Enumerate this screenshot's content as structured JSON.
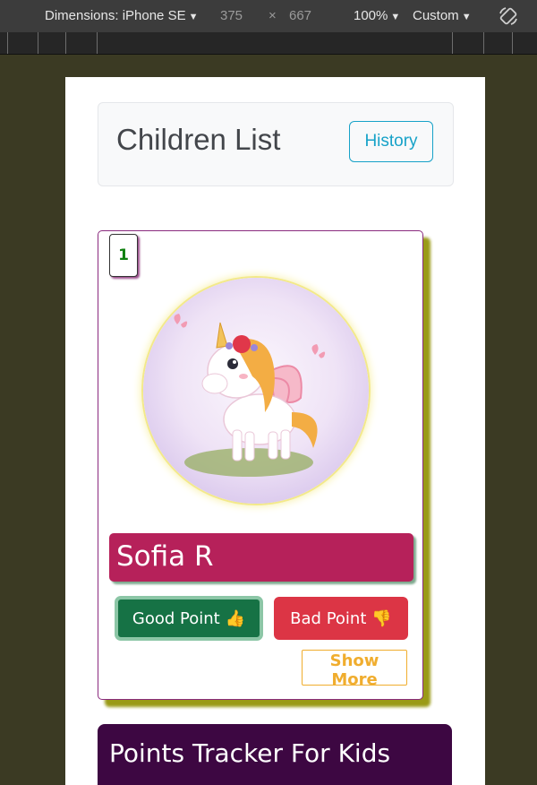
{
  "devtools": {
    "device_label": "Dimensions: iPhone SE",
    "width": "375",
    "times": "×",
    "height": "667",
    "zoom": "100%",
    "throttle": "Custom"
  },
  "header": {
    "title": "Children List",
    "history_label": "History"
  },
  "children": [
    {
      "index": "1",
      "name": "Sofia R",
      "avatar": "unicorn-avatar",
      "good_label": "Good Point",
      "good_emoji": "👍",
      "bad_label": "Bad Point",
      "bad_emoji": "👎",
      "show_more_label": "Show More"
    }
  ],
  "footer": {
    "title": "Points Tracker For Kids"
  },
  "colors": {
    "page_bg": "#3b3a23",
    "name_bar": "#b6215a",
    "good": "#167245",
    "bad": "#dc3545",
    "show_more": "#f0ad2e",
    "footer": "#3d0742",
    "history": "#17a2c8"
  }
}
